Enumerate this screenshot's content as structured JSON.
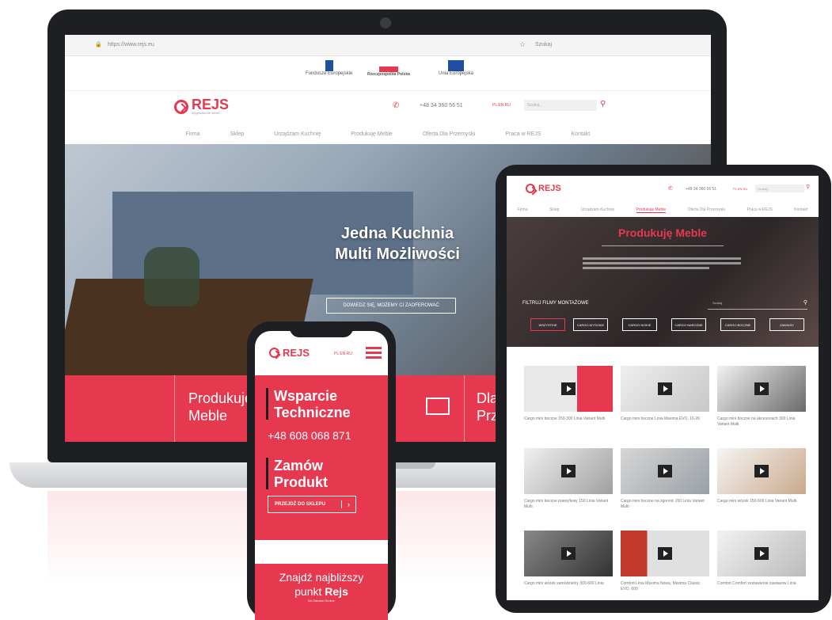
{
  "brand": {
    "name": "REJS",
    "tagline": "Wyposażenie Mebli",
    "accent": "#e63950"
  },
  "laptop": {
    "url": "https://www.rejs.eu",
    "search_label": "Szukaj",
    "funding": [
      "Fundusze Europejskie",
      "Rzeczpospolita Polska",
      "Unia Europejska"
    ],
    "phone": "+48 34 360 56 51",
    "lang": "PL EN RU",
    "search_placeholder": "Szukaj...",
    "nav": [
      "Firma",
      "Sklep",
      "Urządzam Kuchnię",
      "Produkuję Meble",
      "Oferta Dla Przemysłu",
      "Praca w REJS",
      "Kontakt"
    ],
    "hero": {
      "title_line1": "Jedna Kuchnia",
      "title_line2": "Multi Możliwości",
      "button": "DOWIEDZ SIĘ, MOŻEMY CI ZAOFEROWAĆ"
    },
    "band": {
      "item1_l1": "Produkuję",
      "item1_l2": "Meble",
      "item2_l1": "Dla",
      "item2_l2": "Prz"
    }
  },
  "tablet": {
    "phone": "+48 34 360 56 51",
    "lang": "PL EN RU",
    "search": "Szukaj...",
    "nav": [
      "Firma",
      "Sklep",
      "Urządzam Kuchnię",
      "Produkuję Meble",
      "Oferta Dla Przemysłu",
      "Praca w REJS",
      "Kontakt"
    ],
    "hero_title": "Produkuję Meble",
    "filter_label": "FILTRUJ FILMY MONTAŻOWE",
    "filter_search": "Szukaj",
    "chips": [
      "WSZYSTKIE",
      "CARGO WYSOKIE",
      "CARGO NISKIE",
      "CARGO NAROŻNE",
      "CARGO BOCZNE",
      "ZAWIASY"
    ],
    "videos": [
      "Cargo mini boczne 150-300 Linia Variant Multi",
      "Cargo mini boczne Linia Maxima EVO, 16-26",
      "Cargo mini boczne na akcesoriach 300 Linia Variant Multi",
      "Cargo mini boczne prawy/lewy 150 Linia Variant Multi",
      "Cargo mini boczne na zgonnic 150 Linia Variant Multi",
      "Cargo mini wózek 150-600 Linia Variant Multi",
      "Cargo mini wózek samodzielny 300-600 Linia",
      "Comfort Linia Maxima Nowa, Maxima Classic EVO, 600",
      "Comfort Comfort zestawienie zawiasów Linia"
    ]
  },
  "phone": {
    "lang": "PL EN RU",
    "support_l1": "Wsparcie",
    "support_l2": "Techniczne",
    "support_phone": "+48 608 068 871",
    "order_l1": "Zamów",
    "order_l2": "Produkt",
    "shop_button": "PRZEJDŹ DO SKLEPU",
    "find_l1": "Znajdź najbliższy",
    "find_l2": "punkt",
    "find_brand": "Rejs",
    "find_sub": "lub Zamów On-line"
  }
}
